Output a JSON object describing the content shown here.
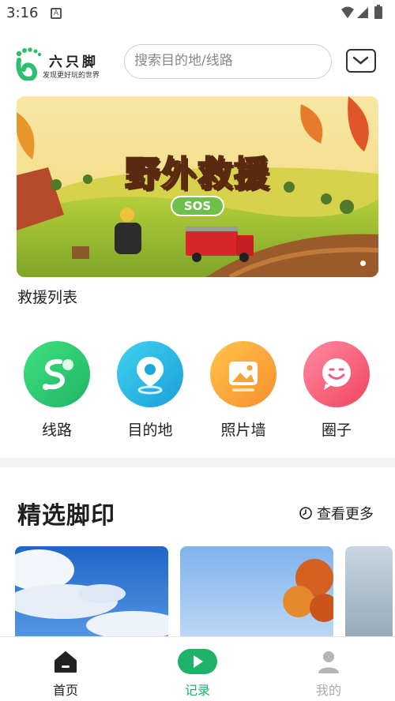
{
  "status_bar": {
    "time": "3:16",
    "notification_icon": "A"
  },
  "header": {
    "app_name": "六只脚",
    "slogan": "发现更好玩的世界",
    "search_placeholder": "搜索目的地/线路"
  },
  "banner": {
    "title": "野外救援",
    "badge": "SOS",
    "caption": "救援列表"
  },
  "nav": [
    {
      "label": "线路",
      "icon": "route-icon",
      "color": "#2ecc71"
    },
    {
      "label": "目的地",
      "icon": "location-pin-icon",
      "color": "#22b8e0"
    },
    {
      "label": "照片墙",
      "icon": "photo-icon",
      "color": "#f7a53a"
    },
    {
      "label": "圈子",
      "icon": "chat-smile-icon",
      "color": "#f35a7a"
    }
  ],
  "featured": {
    "title": "精选脚印",
    "more_label": "查看更多"
  },
  "tabbar": {
    "items": [
      {
        "label": "首页",
        "icon": "home-icon",
        "active": true
      },
      {
        "label": "记录",
        "icon": "play-record-icon",
        "active": false
      },
      {
        "label": "我的",
        "icon": "user-icon",
        "active": false
      }
    ]
  },
  "colors": {
    "brand_green": "#1fb36a",
    "tab_inactive": "#aaaaaa"
  }
}
